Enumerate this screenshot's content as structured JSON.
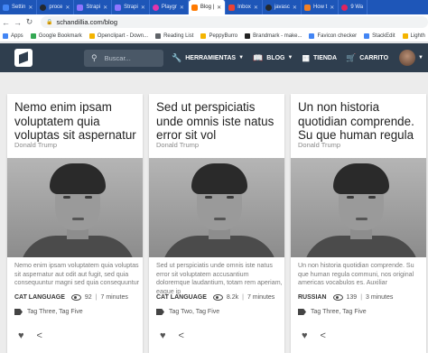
{
  "browser": {
    "tabs": [
      {
        "label": "Settin",
        "icon": "settings-icon",
        "color": "#4285f4",
        "active": false
      },
      {
        "label": "proce",
        "icon": "github-icon",
        "color": "#24292e",
        "active": false
      },
      {
        "label": "Strapi",
        "icon": "strapi-icon",
        "color": "#8e75ff",
        "active": false
      },
      {
        "label": "Strapi",
        "icon": "strapi-icon",
        "color": "#8e75ff",
        "active": false
      },
      {
        "label": "Playgr",
        "icon": "playground-icon",
        "color": "#e535ab",
        "active": false
      },
      {
        "label": "Blog |",
        "icon": "blog-icon",
        "color": "#ff7a00",
        "active": true
      },
      {
        "label": "Inbox",
        "icon": "gmail-icon",
        "color": "#ea4335",
        "active": false
      },
      {
        "label": "javasc",
        "icon": "github-icon",
        "color": "#24292e",
        "active": false
      },
      {
        "label": "How t",
        "icon": "stack-icon",
        "color": "#f48024",
        "active": false
      },
      {
        "label": "9 Wa",
        "icon": "heart-icon",
        "color": "#e0245e",
        "active": false
      }
    ],
    "url": "schandillia.com/blog",
    "bookmarks": [
      {
        "label": "Apps",
        "color": "#4285f4"
      },
      {
        "label": "Google Bookmark",
        "color": "#34a853"
      },
      {
        "label": "Openclipart - Down...",
        "color": "#f4b400"
      },
      {
        "label": "Reading List",
        "color": "#5f6368"
      },
      {
        "label": "PeppyBurro",
        "color": "#f4b400"
      },
      {
        "label": "Brandmark - make...",
        "color": "#222222"
      },
      {
        "label": "Favicon checker",
        "color": "#4285f4"
      },
      {
        "label": "StackEdit",
        "color": "#4285f4"
      },
      {
        "label": "Lighth",
        "color": "#f4b400"
      }
    ]
  },
  "header": {
    "search_placeholder": "Buscar...",
    "menu": {
      "tools": "HERRAMIENTAS",
      "blog": "BLOG",
      "store": "TIENDA",
      "cart": "CARRITO"
    }
  },
  "cards": [
    {
      "title": "Nemo enim ipsam voluptatem quia voluptas sit aspernatur",
      "author": "Donald Trump",
      "excerpt": "Nemo enim ipsam voluptatem quia voluptas sit aspernatur aut odit aut fugit, sed quia consequuntur magni sed quia consequuntur",
      "category": "CAT LANGUAGE",
      "views": "92",
      "read_time": "7 minutes",
      "tags": "Tag Three, Tag Five"
    },
    {
      "title": "Sed ut perspiciatis unde omnis iste natus error sit vol",
      "author": "Donald Trump",
      "excerpt": "Sed ut perspiciatis unde omnis iste natus error sit voluptatem accusantium doloremque laudantium, totam rem aperiam, eaque ip",
      "category": "CAT LANGUAGE",
      "views": "8.2k",
      "read_time": "7 minutes",
      "tags": "Tag Two, Tag Five"
    },
    {
      "title": "Un non historia quotidian comprende. Su que human regula",
      "author": "Donald Trump",
      "excerpt": "Un non historia quotidian comprende. Su que human regula communi, nos original americas vocabulos es. Auxiliar",
      "category": "RUSSIAN",
      "views": "139",
      "read_time": "3 minutes",
      "tags": "Tag Three, Tag Five"
    }
  ]
}
